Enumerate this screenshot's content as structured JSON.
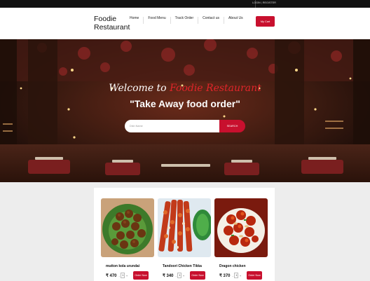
{
  "topbar": {
    "login": "LOGIN",
    "separator": "|",
    "register": "REGISTER"
  },
  "brand": {
    "name": "Foodie\nRestaurant"
  },
  "nav": {
    "items": [
      "Home",
      "Food Menu",
      "Track Order",
      "Contact us",
      "About Us"
    ]
  },
  "cart": {
    "label": "My Cart"
  },
  "hero": {
    "welcome_prefix": "Welcome to ",
    "welcome_name": "Foodie Restaurant",
    "tagline": "\"Take Away food order\"",
    "search_placeholder": "Dish Name",
    "search_button": "SEARCH"
  },
  "colors": {
    "accent": "#c8102e",
    "topbar": "#111111",
    "page_bg": "#ededed"
  },
  "cards": [
    {
      "title": "mutton kola urundai",
      "price": "₹ 470",
      "qty": "1",
      "minus": "-",
      "plus": "+",
      "order": "Order Now"
    },
    {
      "title": "Tandoori Chicken Tikka",
      "price": "₹ 340",
      "qty": "1",
      "minus": "-",
      "plus": "+",
      "order": "Order Now"
    },
    {
      "title": "Dragon chicken",
      "price": "₹ 370",
      "qty": "1",
      "minus": "-",
      "plus": "+",
      "order": "Order Now"
    }
  ]
}
